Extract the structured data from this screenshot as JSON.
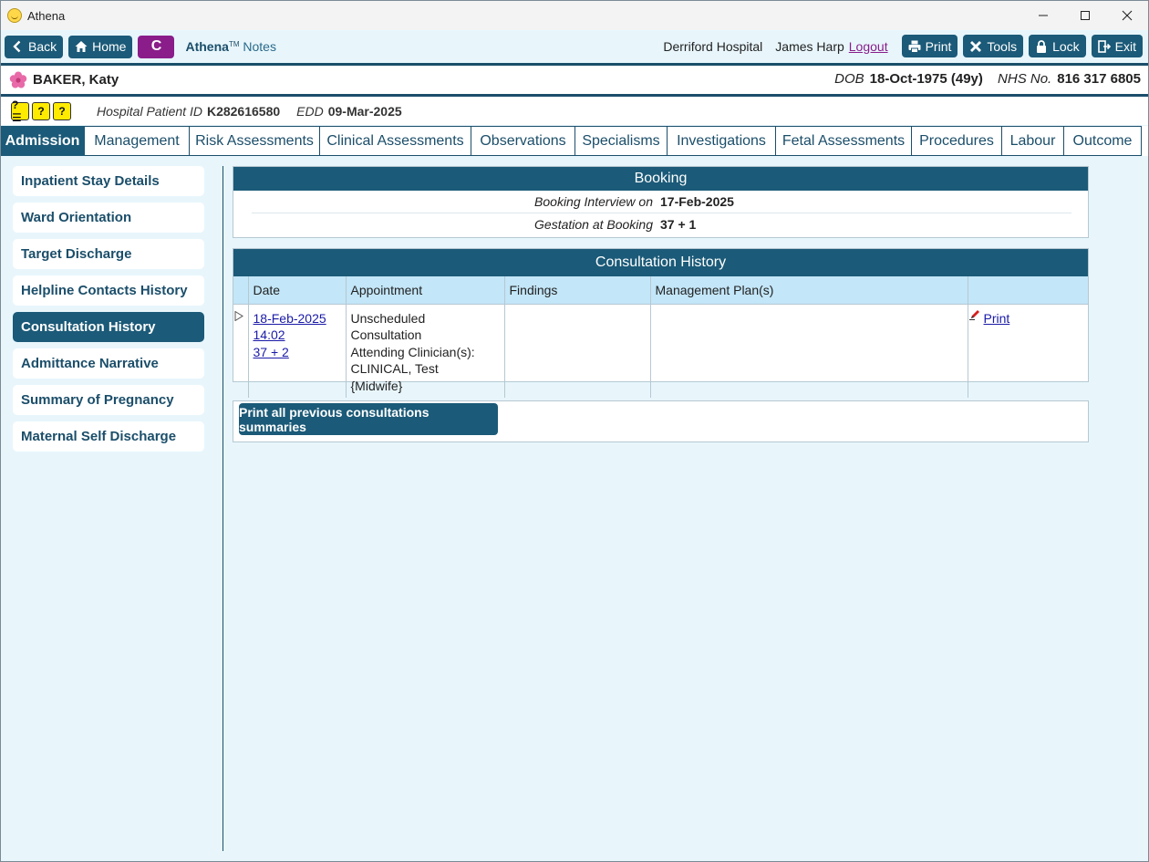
{
  "window": {
    "title": "Athena",
    "icon": "athena-smiley-icon"
  },
  "toolbar": {
    "back_label": "Back",
    "home_label": "Home",
    "c_label": "C",
    "brand_name": "Athena",
    "brand_tm": "TM",
    "brand_module": "Notes",
    "hospital": "Derriford Hospital",
    "user": "James Harp",
    "logout_label": "Logout",
    "print_label": "Print",
    "tools_label": "Tools",
    "lock_label": "Lock",
    "exit_label": "Exit"
  },
  "patient": {
    "name": "BAKER, Katy",
    "dob_label": "DOB",
    "dob_value": "18-Oct-1975 (49y)",
    "nhs_label": "NHS No.",
    "nhs_value": "816 317 6805",
    "hospital_id_label": "Hospital Patient ID",
    "hospital_id_value": "K282616580",
    "edd_label": "EDD",
    "edd_value": "09-Mar-2025"
  },
  "alert_icons": [
    "?☰",
    "?",
    "?"
  ],
  "tabs": [
    {
      "label": "Admission",
      "active": true
    },
    {
      "label": "Management",
      "active": false
    },
    {
      "label": "Risk Assessments",
      "active": false
    },
    {
      "label": "Clinical Assessments",
      "active": false
    },
    {
      "label": "Observations",
      "active": false
    },
    {
      "label": "Specialisms",
      "active": false
    },
    {
      "label": "Investigations",
      "active": false
    },
    {
      "label": "Fetal Assessments",
      "active": false
    },
    {
      "label": "Procedures",
      "active": false
    },
    {
      "label": "Labour",
      "active": false
    },
    {
      "label": "Outcome",
      "active": false
    }
  ],
  "sidebar": {
    "items": [
      {
        "label": "Inpatient Stay Details",
        "active": false
      },
      {
        "label": "Ward Orientation",
        "active": false
      },
      {
        "label": "Target Discharge",
        "active": false
      },
      {
        "label": "Helpline Contacts History",
        "active": false
      },
      {
        "label": "Consultation History",
        "active": true
      },
      {
        "label": "Admittance Narrative",
        "active": false
      },
      {
        "label": "Summary of Pregnancy",
        "active": false
      },
      {
        "label": "Maternal Self Discharge",
        "active": false
      }
    ]
  },
  "booking": {
    "title": "Booking",
    "interview_label": "Booking Interview on",
    "interview_value": "17-Feb-2025",
    "gestation_label": "Gestation at Booking",
    "gestation_value": "37 + 1"
  },
  "consultation": {
    "title": "Consultation History",
    "columns": [
      "Date",
      "Appointment",
      "Findings",
      "Management Plan(s)",
      ""
    ],
    "rows": [
      {
        "date": "18-Feb-2025",
        "time": "14:02",
        "gestation": "37 + 2",
        "appointment_lines": [
          "Unscheduled Consultation",
          "Attending Clinician(s):",
          "CLINICAL, Test",
          "{Midwife}"
        ],
        "findings": "",
        "management": "",
        "action_label": "Print"
      }
    ],
    "print_all_label": "Print all previous consultations summaries"
  },
  "colors": {
    "primary": "#1b5a78",
    "background": "#e8f6fc",
    "accent_purple": "#8a1d8a",
    "table_header": "#c3e6f8"
  }
}
